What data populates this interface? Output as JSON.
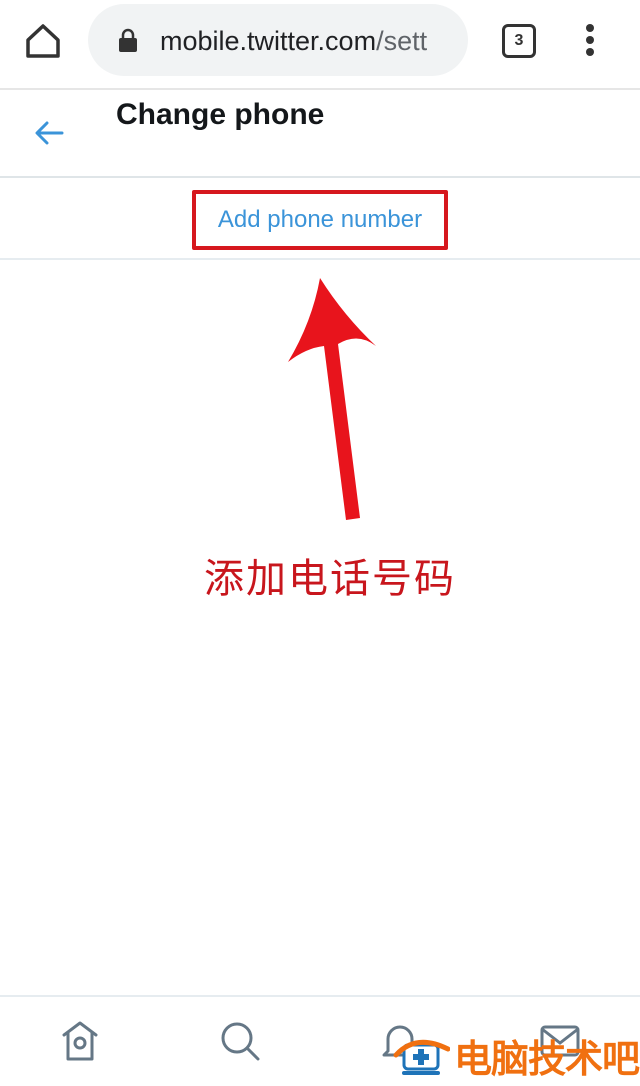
{
  "browser": {
    "url_main": "mobile.twitter.com",
    "url_rest": "/sett",
    "tab_count": "3",
    "icons": {
      "home": "home-icon",
      "lock": "lock-icon",
      "tabs": "tab-switcher-icon",
      "menu": "more-vertical-icon"
    }
  },
  "header": {
    "title": "Change phone",
    "back_icon": "arrow-left-icon"
  },
  "main": {
    "add_phone_label": "Add phone number",
    "accent_color": "#3b94d9",
    "highlight_color": "#d6181e"
  },
  "annotation": {
    "label": "添加电话号码",
    "color": "#c8161d"
  },
  "bottom_nav": {
    "items": [
      {
        "name": "home",
        "icon": "home-icon"
      },
      {
        "name": "search",
        "icon": "search-icon"
      },
      {
        "name": "notifications",
        "icon": "bell-icon"
      },
      {
        "name": "messages",
        "icon": "mail-icon"
      }
    ]
  },
  "watermark": {
    "text": "电脑技术吧"
  }
}
